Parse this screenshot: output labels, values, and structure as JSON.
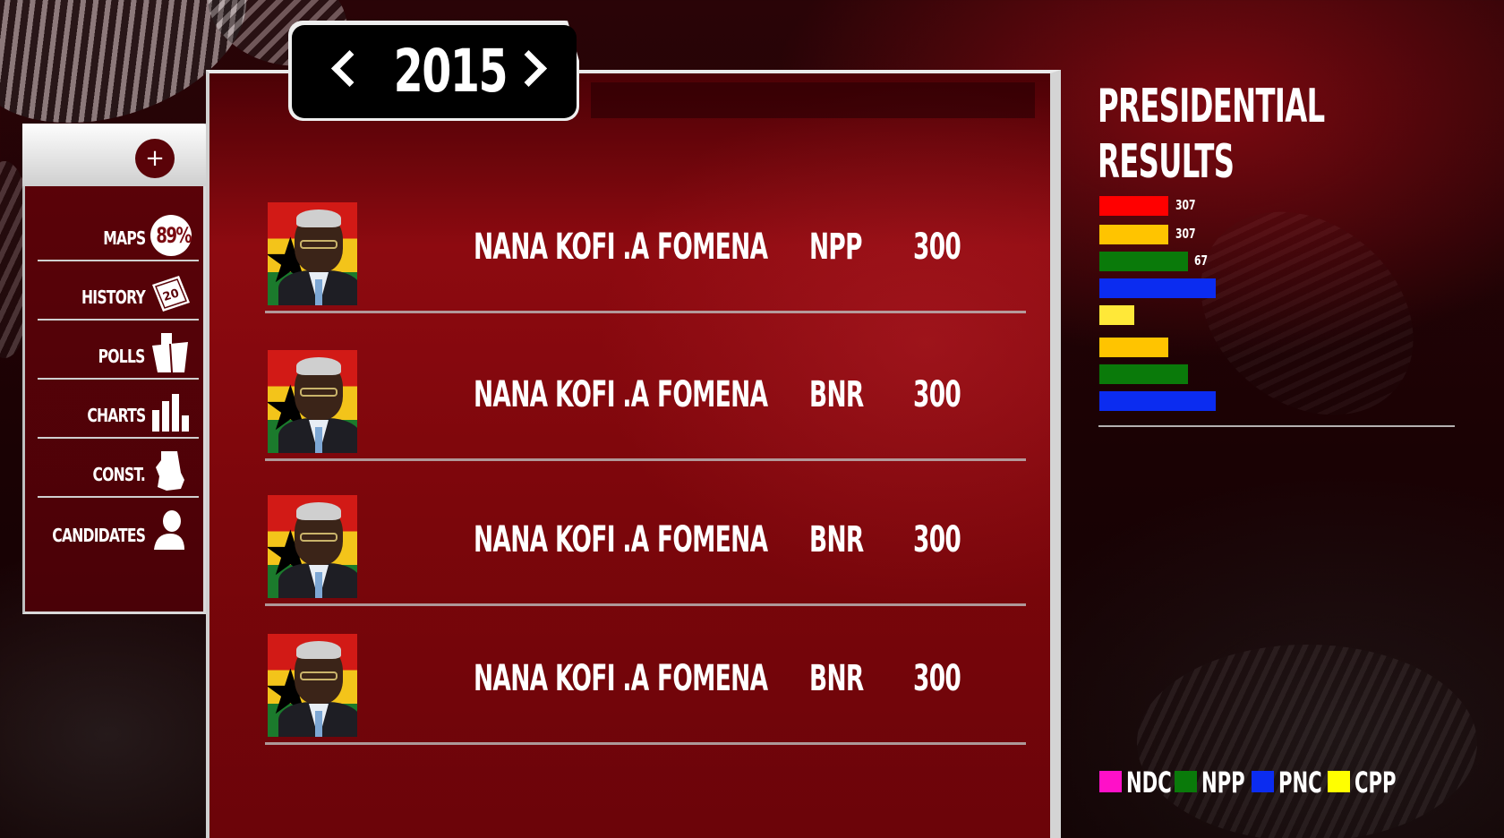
{
  "sidebar": {
    "add_label": "+",
    "items": [
      {
        "label": "MAPS",
        "badge": "89%",
        "icon": "percent-badge-icon"
      },
      {
        "label": "HISTORY",
        "icon": "calendar-icon",
        "icon_text": "20"
      },
      {
        "label": "POLLS",
        "icon": "ballot-box-icon"
      },
      {
        "label": "CHARTS",
        "icon": "bar-chart-icon"
      },
      {
        "label": "CONST.",
        "icon": "ghana-map-icon"
      },
      {
        "label": "CANDIDATES",
        "icon": "person-icon"
      }
    ]
  },
  "year_selector": {
    "year": "2015",
    "prev_icon": "chevron-left-icon",
    "next_icon": "chevron-right-icon"
  },
  "candidates": [
    {
      "name": "NANA KOFI .A",
      "constituency": "FOMENA",
      "party": "NPP",
      "votes": "300"
    },
    {
      "name": "NANA KOFI .A",
      "constituency": "FOMENA",
      "party": "BNR",
      "votes": "300"
    },
    {
      "name": "NANA KOFI .A",
      "constituency": "FOMENA",
      "party": "BNR",
      "votes": "300"
    },
    {
      "name": "NANA KOFI .A",
      "constituency": "FOMENA",
      "party": "BNR",
      "votes": "300"
    }
  ],
  "results": {
    "title_line1": "PRESIDENTIAL",
    "title_line2": "RESULTS",
    "bars": [
      {
        "label": "307",
        "color": "#ff0000"
      },
      {
        "label": "307",
        "color": "#ffc400"
      },
      {
        "label": "67",
        "color": "#0a7a0a"
      },
      {
        "label": "",
        "color": "#0b2cf0"
      },
      {
        "label": "",
        "color": "#ffe838"
      },
      {
        "label": "",
        "color": "#ffc400"
      },
      {
        "label": "",
        "color": "#0a7a0a"
      },
      {
        "label": "",
        "color": "#0b2cf0"
      }
    ],
    "legend": [
      {
        "label": "NDC",
        "color": "#ff10c8"
      },
      {
        "label": "NPP",
        "color": "#0a7a0a"
      },
      {
        "label": "PNC",
        "color": "#0b2cf0"
      },
      {
        "label": "CPP",
        "color": "#ffff00"
      }
    ]
  }
}
